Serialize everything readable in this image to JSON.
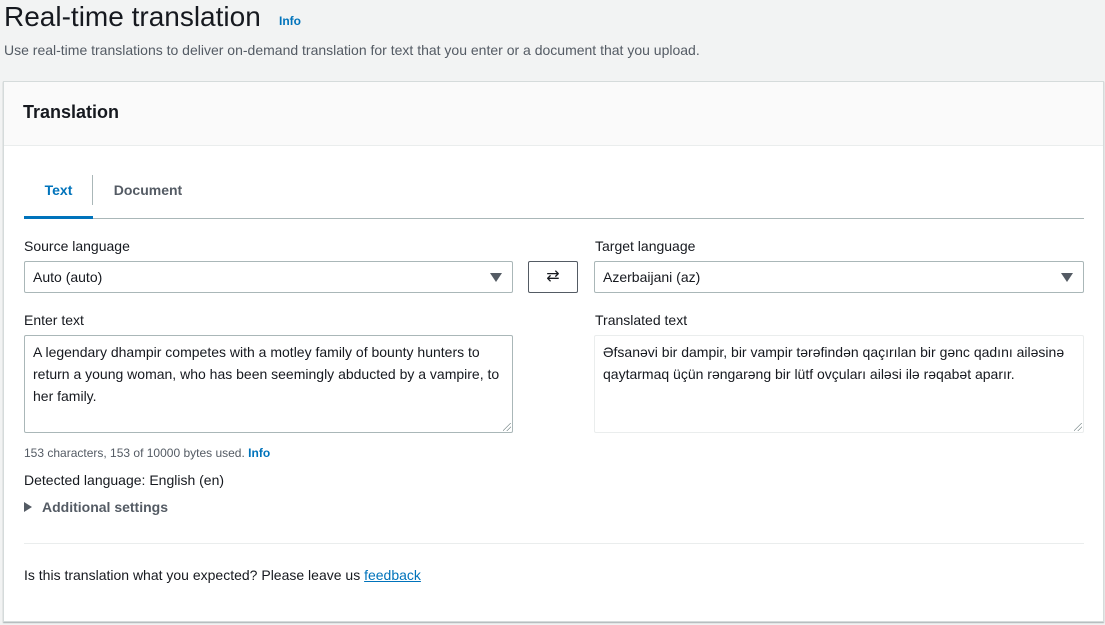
{
  "header": {
    "title": "Real-time translation",
    "info_label": "Info",
    "description": "Use real-time translations to deliver on-demand translation for text that you enter or a document that you upload."
  },
  "panel": {
    "title": "Translation",
    "tabs": [
      {
        "label": "Text",
        "active": true
      },
      {
        "label": "Document",
        "active": false
      }
    ],
    "source": {
      "label": "Source language",
      "selected": "Auto (auto)"
    },
    "target": {
      "label": "Target language",
      "selected": "Azerbaijani (az)"
    },
    "swap_icon": "⇄",
    "input": {
      "label": "Enter text",
      "value": "A legendary dhampir competes with a motley family of bounty hunters to return a young woman, who has been seemingly abducted by a vampire, to her family."
    },
    "output": {
      "label": "Translated text",
      "value": "Əfsanəvi bir dampir, bir vampir tərəfindən qaçırılan bir gənc qadını ailəsinə qaytarmaq üçün rəngarəng bir lütf ovçuları ailəsi ilə rəqabət aparır."
    },
    "char_count": "153 characters, 153 of 10000 bytes used.",
    "char_count_info": "Info",
    "detected_language": "Detected language: English (en)",
    "additional_settings": "Additional settings",
    "feedback_text": "Is this translation what you expected? Please leave us",
    "feedback_link": "feedback"
  },
  "colors": {
    "link": "#0073bb",
    "text": "#16191f",
    "muted": "#545b64",
    "background": "#f2f3f3"
  }
}
